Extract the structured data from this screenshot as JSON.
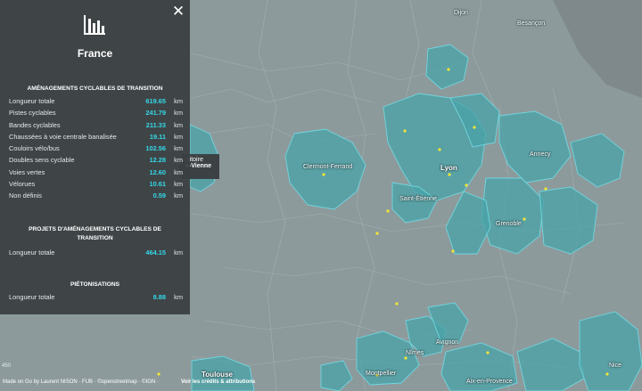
{
  "panel": {
    "country": "France",
    "close_icon": "close-icon",
    "chart_icon": "bar-chart-icon",
    "section_amenagements": {
      "title": "AMÉNAGEMENTS CYCLABLES DE TRANSITION",
      "rows": [
        {
          "label": "Longueur totale",
          "value": "619.65",
          "unit": "km"
        },
        {
          "label": "Pistes cyclables",
          "value": "241.79",
          "unit": "km"
        },
        {
          "label": "Bandes cyclables",
          "value": "211.33",
          "unit": "km"
        },
        {
          "label": "Chaussées à voie centrale banalisée",
          "value": "19.11",
          "unit": "km"
        },
        {
          "label": "Couloirs vélo/bus",
          "value": "102.56",
          "unit": "km"
        },
        {
          "label": "Doubles sens cyclable",
          "value": "12.28",
          "unit": "km"
        },
        {
          "label": "Voies vertes",
          "value": "12.60",
          "unit": "km"
        },
        {
          "label": "Vélorues",
          "value": "10.61",
          "unit": "km"
        },
        {
          "label": "Non définis",
          "value": "0.59",
          "unit": "km"
        }
      ]
    },
    "section_projets": {
      "title_line1": "PROJETS D'AMÉNAGEMENTS CYCLABLES DE",
      "title_line2": "TRANSITION",
      "rows": [
        {
          "label": "Longueur totale",
          "value": "464.15",
          "unit": "km"
        }
      ]
    },
    "section_pietonisations": {
      "title": "PIÉTONISATIONS",
      "rows": [
        {
          "label": "Longueur totale",
          "value": "8.88",
          "unit": "km"
        }
      ]
    }
  },
  "tooltip": {
    "line1": "rritoire",
    "line2": "e-Vienne"
  },
  "map": {
    "cities": [
      {
        "name": "Dijon"
      },
      {
        "name": "Besançon"
      },
      {
        "name": "Clermont-Ferrand"
      },
      {
        "name": "Lyon"
      },
      {
        "name": "Saint-Étienne"
      },
      {
        "name": "Annecy"
      },
      {
        "name": "Grenoble"
      },
      {
        "name": "Nîmes"
      },
      {
        "name": "Avignon"
      },
      {
        "name": "Montpellier"
      },
      {
        "name": "Toulouse"
      },
      {
        "name": "Aix-en-Provence"
      },
      {
        "name": "Nice"
      }
    ],
    "colors": {
      "land": "#8d9a9c",
      "region_fill": "#4aa3a8",
      "region_border": "#6fd6df",
      "dot": "#f2e633"
    }
  },
  "footer": {
    "attribution": "Made on Go by Laurent NISON · FUB · ©openstreetmap · ©IGN ·",
    "credits_link": "Voir les crédits & attributions"
  },
  "scale_text": "450"
}
